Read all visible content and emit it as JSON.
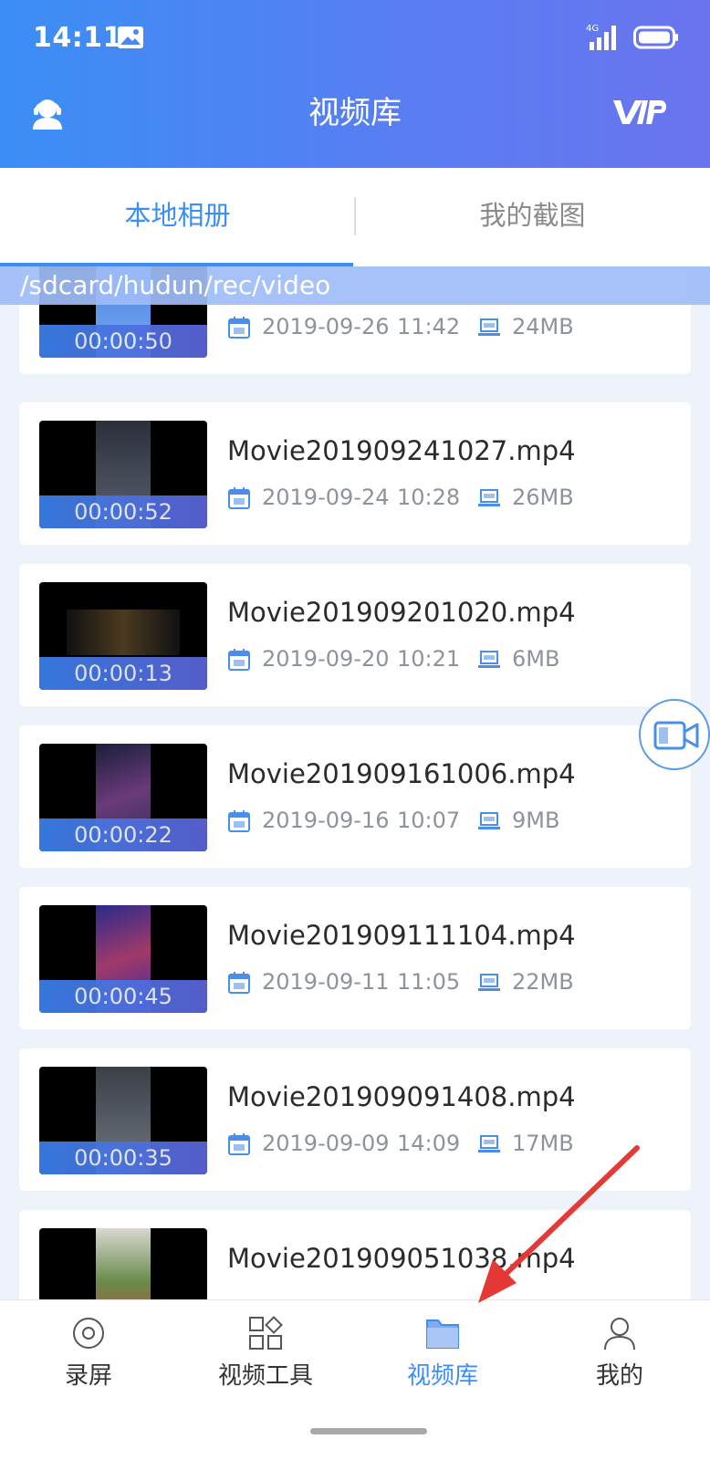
{
  "status_bar": {
    "time": "14:11",
    "network": "4G"
  },
  "header": {
    "title": "视频库"
  },
  "tabs": [
    {
      "label": "本地相册",
      "active": true
    },
    {
      "label": "我的截图",
      "active": false
    }
  ],
  "path": "/sdcard/hudun/rec/video",
  "videos": [
    {
      "name": "",
      "date": "2019-09-26",
      "time": "11:42",
      "size": "24MB",
      "duration": "00:00:50"
    },
    {
      "name": "Movie201909241027.mp4",
      "date": "2019-09-24",
      "time": "10:28",
      "size": "26MB",
      "duration": "00:00:52"
    },
    {
      "name": "Movie201909201020.mp4",
      "date": "2019-09-20",
      "time": "10:21",
      "size": "6MB",
      "duration": "00:00:13"
    },
    {
      "name": "Movie201909161006.mp4",
      "date": "2019-09-16",
      "time": "10:07",
      "size": "9MB",
      "duration": "00:00:22"
    },
    {
      "name": "Movie201909111104.mp4",
      "date": "2019-09-11",
      "time": "11:05",
      "size": "22MB",
      "duration": "00:00:45"
    },
    {
      "name": "Movie201909091408.mp4",
      "date": "2019-09-09",
      "time": "14:09",
      "size": "17MB",
      "duration": "00:00:35"
    },
    {
      "name": "Movie201909051038.mp4",
      "date": "",
      "time": "",
      "size": "",
      "duration": ""
    }
  ],
  "bottom_nav": [
    {
      "label": "录屏",
      "icon": "record-icon",
      "active": false
    },
    {
      "label": "视频工具",
      "icon": "tools-icon",
      "active": false
    },
    {
      "label": "视频库",
      "icon": "folder-icon",
      "active": true
    },
    {
      "label": "我的",
      "icon": "profile-icon",
      "active": false
    }
  ],
  "colors": {
    "accent": "#3b8ef5",
    "header_start": "#3b8ef5",
    "header_end": "#6a74ee",
    "annotation": "#e53935"
  }
}
